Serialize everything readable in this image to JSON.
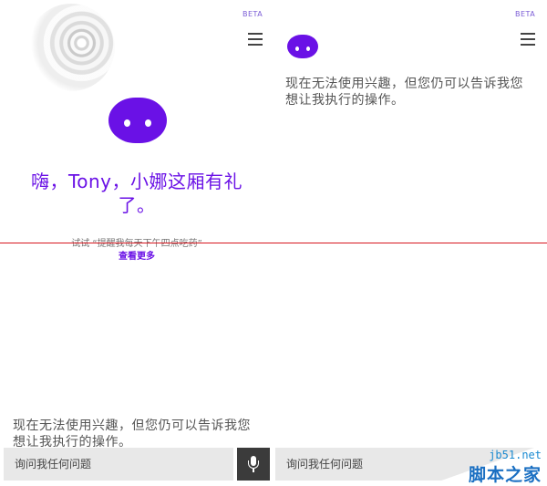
{
  "left": {
    "beta": "BETA",
    "greeting": "嗨，Tony，小娜这厢有礼了。",
    "hint": "试试 “提醒我每天下午四点吃药”",
    "more_link": "查看更多",
    "offline_message": "现在无法使用兴趣，但您仍可以告诉我您想让我执行的操作。",
    "search_placeholder": "询问我任何问题"
  },
  "right": {
    "beta": "BETA",
    "offline_message": "现在无法使用兴趣，但您仍可以告诉我您想让我执行的操作。",
    "search_placeholder": "询问我任何问题"
  },
  "watermark": {
    "domain": "jb51.net",
    "name": "脚本之家"
  },
  "colors": {
    "accent": "#6a11e6",
    "divider": "#d7171f",
    "input_bg": "#e8e8e8",
    "mic_bg": "#3b3b3b"
  },
  "icons": [
    "swirl-logo-icon",
    "cortana-face-icon",
    "hamburger-menu-icon",
    "microphone-icon"
  ]
}
